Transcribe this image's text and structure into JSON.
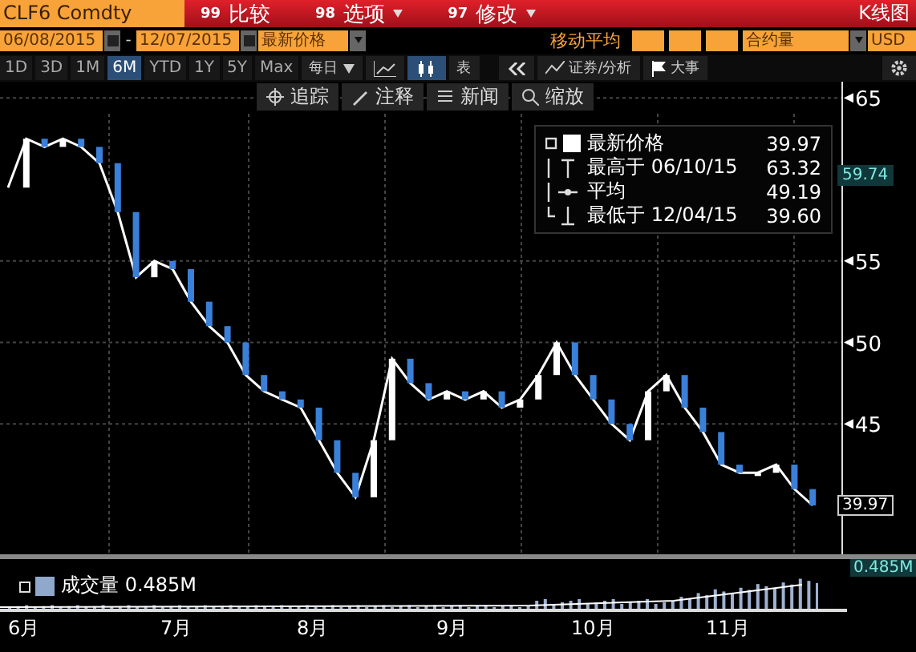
{
  "header": {
    "ticker": "CLF6 Comdty",
    "menus": [
      {
        "code": "99",
        "label": "比较",
        "dropdown": false
      },
      {
        "code": "98",
        "label": "选项",
        "dropdown": true
      },
      {
        "code": "97",
        "label": "修改",
        "dropdown": true
      }
    ],
    "view": "K线图"
  },
  "controls": {
    "start_date": "06/08/2015",
    "separator": "-",
    "end_date": "12/07/2015",
    "price_field": "最新价格",
    "moving_average_label": "移动平均",
    "volume_field": "合约量",
    "currency": "USD"
  },
  "ranges": [
    {
      "label": "1D",
      "selected": false
    },
    {
      "label": "3D",
      "selected": false
    },
    {
      "label": "1M",
      "selected": false
    },
    {
      "label": "6M",
      "selected": true
    },
    {
      "label": "YTD",
      "selected": false
    },
    {
      "label": "1Y",
      "selected": false
    },
    {
      "label": "5Y",
      "selected": false
    },
    {
      "label": "Max",
      "selected": false
    }
  ],
  "period": "每日",
  "table_button": "表",
  "analysis_button": "证券/分析",
  "events_button": "大事",
  "chart_tools": [
    "追踪",
    "注释",
    "新闻",
    "缩放"
  ],
  "legend": [
    {
      "kind": "last",
      "label": "最新价格",
      "value": "39.97"
    },
    {
      "kind": "high",
      "label": "最高于",
      "date": "06/10/15",
      "value": "63.32"
    },
    {
      "kind": "average",
      "label": "平均",
      "value": "49.19"
    },
    {
      "kind": "low",
      "label": "最低于",
      "date": "12/04/15",
      "value": "39.60"
    }
  ],
  "price_badges": [
    {
      "kind": "average",
      "value": "59.74"
    },
    {
      "kind": "last",
      "value": "39.97"
    }
  ],
  "chart_data": {
    "type": "line",
    "ylim": [
      37,
      66
    ],
    "yticks": [
      45,
      50,
      55,
      65
    ],
    "grid": true,
    "series": [
      {
        "color": "#ffffff",
        "values": [
          59.5,
          62.5,
          62,
          62.5,
          62,
          61,
          58,
          54,
          55,
          54.5,
          52.5,
          51,
          50,
          48,
          47,
          46.5,
          46,
          44,
          42,
          40.5,
          44,
          49,
          47.5,
          46.5,
          47,
          46.5,
          47,
          46,
          46.5,
          48,
          50,
          48,
          46.5,
          45,
          44,
          47,
          48,
          46,
          44.5,
          42.5,
          42,
          42,
          42.5,
          41,
          40
        ]
      }
    ]
  },
  "volume": {
    "label": "成交量",
    "value": "0.485M",
    "badge": "0.485M"
  },
  "months": [
    "6月",
    "7月",
    "8月",
    "9月",
    "10月",
    "11月"
  ]
}
